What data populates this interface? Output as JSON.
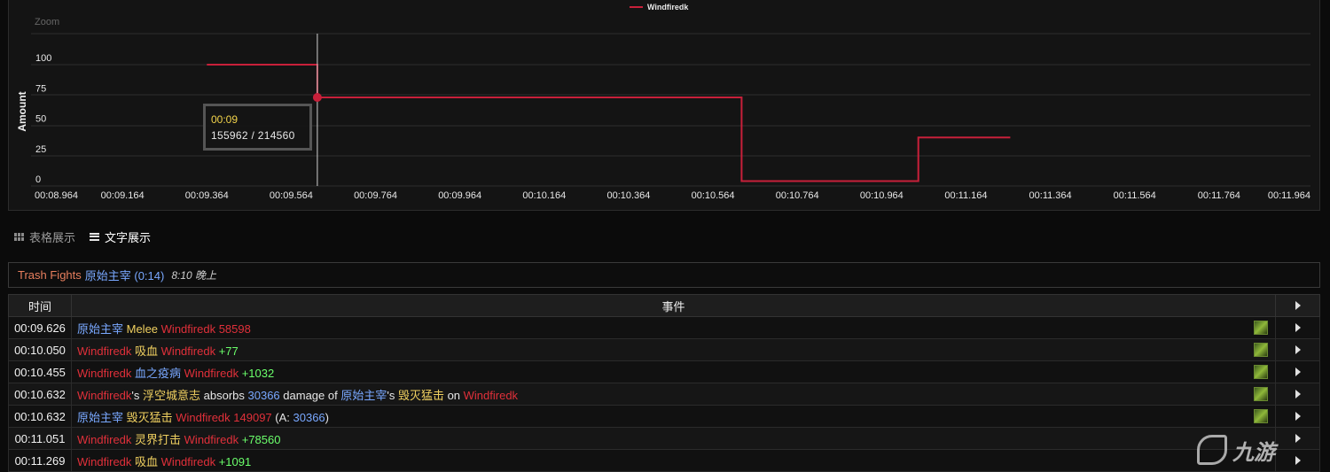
{
  "chart_data": {
    "type": "line",
    "title": "",
    "zoom_label": "Zoom",
    "ylabel": "Amount",
    "xlabel": "",
    "ylim": [
      0,
      100
    ],
    "y_ticks": [
      "0",
      "25",
      "50",
      "75",
      "100"
    ],
    "x_ticks": [
      "00:08.964",
      "00:09.164",
      "00:09.364",
      "00:09.564",
      "00:09.764",
      "00:09.964",
      "00:10.164",
      "00:10.364",
      "00:10.564",
      "00:10.764",
      "00:10.964",
      "00:11.164",
      "00:11.364",
      "00:11.564",
      "00:11.764",
      "00:11.964"
    ],
    "legend": {
      "position": "top-center",
      "entries": [
        "Windfiredk"
      ]
    },
    "grid": true,
    "series": [
      {
        "name": "Windfiredk",
        "color": "#c8203a",
        "step": true,
        "points": [
          {
            "x": "00:09.364",
            "y": 100
          },
          {
            "x": "00:09.626",
            "y": 100
          },
          {
            "x": "00:09.626",
            "y": 73
          },
          {
            "x": "00:10.632",
            "y": 73
          },
          {
            "x": "00:10.632",
            "y": 4
          },
          {
            "x": "00:11.051",
            "y": 4
          },
          {
            "x": "00:11.051",
            "y": 40
          },
          {
            "x": "00:11.269",
            "y": 40
          }
        ]
      }
    ],
    "tooltip": {
      "time": "00:09",
      "value": "155962 / 214560"
    }
  },
  "view_tabs": [
    {
      "label": "表格展示",
      "icon": "grid-icon",
      "active": false
    },
    {
      "label": "文字展示",
      "icon": "list-icon",
      "active": true
    }
  ],
  "fight": {
    "category": "Trash Fights",
    "boss": "原始主宰 (0:14)",
    "time": "8:10 晚上"
  },
  "table": {
    "headers": {
      "time": "时间",
      "event": "事件"
    },
    "rows": [
      {
        "time": "00:09.626",
        "parts": [
          {
            "t": "原始主宰",
            "c": "c-boss"
          },
          {
            "t": " Melee ",
            "c": "c-abil"
          },
          {
            "t": "Windfiredk",
            "c": "c-player"
          },
          {
            "t": " 58598",
            "c": "c-dmg"
          }
        ]
      },
      {
        "time": "00:10.050",
        "parts": [
          {
            "t": "Windfiredk",
            "c": "c-player"
          },
          {
            "t": " 吸血 ",
            "c": "c-abil"
          },
          {
            "t": "Windfiredk",
            "c": "c-player"
          },
          {
            "t": " +77",
            "c": "c-heal"
          }
        ]
      },
      {
        "time": "00:10.455",
        "parts": [
          {
            "t": "Windfiredk",
            "c": "c-player"
          },
          {
            "t": " 血之疫病 ",
            "c": "c-boss"
          },
          {
            "t": "Windfiredk",
            "c": "c-player"
          },
          {
            "t": " +1032",
            "c": "c-heal"
          }
        ]
      },
      {
        "time": "00:10.632",
        "parts": [
          {
            "t": "Windfiredk",
            "c": "c-player"
          },
          {
            "t": "'s ",
            "c": "c-plain"
          },
          {
            "t": "浮空城意志",
            "c": "c-abil"
          },
          {
            "t": " absorbs ",
            "c": "c-plain"
          },
          {
            "t": "30366",
            "c": "c-num"
          },
          {
            "t": " damage of ",
            "c": "c-plain"
          },
          {
            "t": "原始主宰",
            "c": "c-boss"
          },
          {
            "t": "'s ",
            "c": "c-plain"
          },
          {
            "t": "毁灭猛击",
            "c": "c-abil"
          },
          {
            "t": " on ",
            "c": "c-plain"
          },
          {
            "t": "Windfiredk",
            "c": "c-player"
          }
        ]
      },
      {
        "time": "00:10.632",
        "parts": [
          {
            "t": "原始主宰",
            "c": "c-boss"
          },
          {
            "t": " 毁灭猛击 ",
            "c": "c-abil"
          },
          {
            "t": "Windfiredk",
            "c": "c-player"
          },
          {
            "t": " 149097",
            "c": "c-dmg"
          },
          {
            "t": " (A: ",
            "c": "c-plain"
          },
          {
            "t": "30366",
            "c": "c-num"
          },
          {
            "t": ")",
            "c": "c-plain"
          }
        ]
      },
      {
        "time": "00:11.051",
        "parts": [
          {
            "t": "Windfiredk",
            "c": "c-player"
          },
          {
            "t": " 灵界打击 ",
            "c": "c-abil"
          },
          {
            "t": "Windfiredk",
            "c": "c-player"
          },
          {
            "t": " +78560",
            "c": "c-heal"
          }
        ]
      },
      {
        "time": "00:11.269",
        "parts": [
          {
            "t": "Windfiredk",
            "c": "c-player"
          },
          {
            "t": " 吸血 ",
            "c": "c-abil"
          },
          {
            "t": "Windfiredk",
            "c": "c-player"
          },
          {
            "t": " +1091",
            "c": "c-heal"
          }
        ]
      }
    ]
  },
  "watermark": {
    "text": "九游"
  }
}
